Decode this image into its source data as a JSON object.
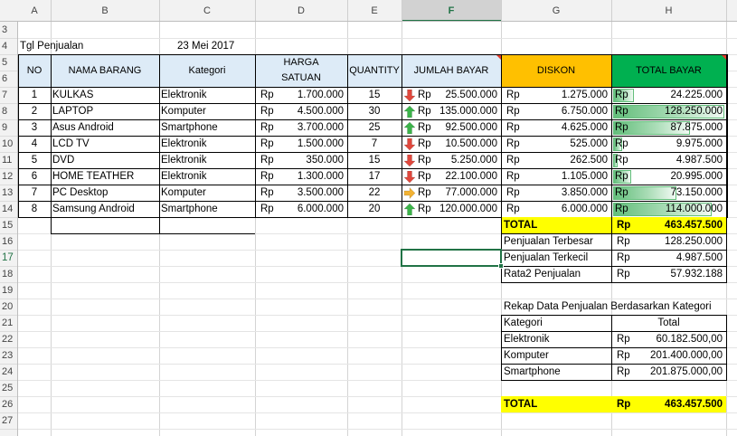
{
  "columns": [
    "A",
    "B",
    "C",
    "D",
    "E",
    "F",
    "G",
    "H"
  ],
  "row_numbers": [
    "3",
    "4",
    "5",
    "6",
    "7",
    "8",
    "9",
    "10",
    "11",
    "12",
    "13",
    "14",
    "15",
    "16",
    "17",
    "18",
    "19",
    "20",
    "21",
    "22",
    "23",
    "24",
    "25",
    "26",
    "27"
  ],
  "sale_date": {
    "label": "Tgl Penjualan",
    "value": "23 Mei 2017"
  },
  "headers": {
    "no": "NO",
    "item_name": "NAMA BARANG",
    "category": "Kategori",
    "unit_price_1": "HARGA",
    "unit_price_2": "SATUAN",
    "quantity": "QUANTITY",
    "amount_paid": "JUMLAH BAYAR",
    "discount": "DISKON",
    "total_paid": "TOTAL BAYAR"
  },
  "currency": "Rp",
  "rows": [
    {
      "no": "1",
      "name": "KULKAS",
      "category": "Elektronik",
      "price": "1.700.000",
      "qty": "15",
      "amount": "25.500.000",
      "discount": "1.275.000",
      "total": "24.225.000",
      "trend": "down",
      "bar": 0.19
    },
    {
      "no": "2",
      "name": "LAPTOP",
      "category": "Komputer",
      "price": "4.500.000",
      "qty": "30",
      "amount": "135.000.000",
      "discount": "6.750.000",
      "total": "128.250.000",
      "trend": "up",
      "bar": 1.0
    },
    {
      "no": "3",
      "name": "Asus Android",
      "category": "Smartphone",
      "price": "3.700.000",
      "qty": "25",
      "amount": "92.500.000",
      "discount": "4.625.000",
      "total": "87.875.000",
      "trend": "up",
      "bar": 0.69
    },
    {
      "no": "4",
      "name": "LCD TV",
      "category": "Elektronik",
      "price": "1.500.000",
      "qty": "7",
      "amount": "10.500.000",
      "discount": "525.000",
      "total": "9.975.000",
      "trend": "down",
      "bar": 0.08
    },
    {
      "no": "5",
      "name": "DVD",
      "category": "Elektronik",
      "price": "350.000",
      "qty": "15",
      "amount": "5.250.000",
      "discount": "262.500",
      "total": "4.987.500",
      "trend": "down",
      "bar": 0.04
    },
    {
      "no": "6",
      "name": "HOME TEATHER",
      "category": "Elektronik",
      "price": "1.300.000",
      "qty": "17",
      "amount": "22.100.000",
      "discount": "1.105.000",
      "total": "20.995.000",
      "trend": "down",
      "bar": 0.16
    },
    {
      "no": "7",
      "name": "PC Desktop",
      "category": "Komputer",
      "price": "3.500.000",
      "qty": "22",
      "amount": "77.000.000",
      "discount": "3.850.000",
      "total": "73.150.000",
      "trend": "right",
      "bar": 0.57
    },
    {
      "no": "8",
      "name": "Samsung Android",
      "category": "Smartphone",
      "price": "6.000.000",
      "qty": "20",
      "amount": "120.000.000",
      "discount": "6.000.000",
      "total": "114.000.000",
      "trend": "up",
      "bar": 0.89
    }
  ],
  "summary": [
    {
      "label": "TOTAL",
      "value": "463.457.500"
    },
    {
      "label": "Penjualan Terbesar",
      "value": "128.250.000"
    },
    {
      "label": "Penjualan Terkecil",
      "value": "4.987.500"
    },
    {
      "label": "Rata2 Penjualan",
      "value": "57.932.188"
    }
  ],
  "recap": {
    "title": "Rekap Data Penjualan Berdasarkan Kategori",
    "col_category": "Kategori",
    "col_total": "Total",
    "rows": [
      {
        "category": "Elektronik",
        "value": "60.182.500,00"
      },
      {
        "category": "Komputer",
        "value": "201.400.000,00"
      },
      {
        "category": "Smartphone",
        "value": "201.875.000,00"
      }
    ],
    "total_label": "TOTAL",
    "total_value": "463.457.500"
  },
  "colors": {
    "yellow": "#FFFF00",
    "orange": "#FFC000",
    "green": "#00B050",
    "header_blue": "#DDEBF7",
    "grid": "#D4D4D4",
    "selection": "#217346",
    "arrow_up": "#3CB34A",
    "arrow_down": "#E0483D",
    "arrow_right": "#F2B233"
  }
}
